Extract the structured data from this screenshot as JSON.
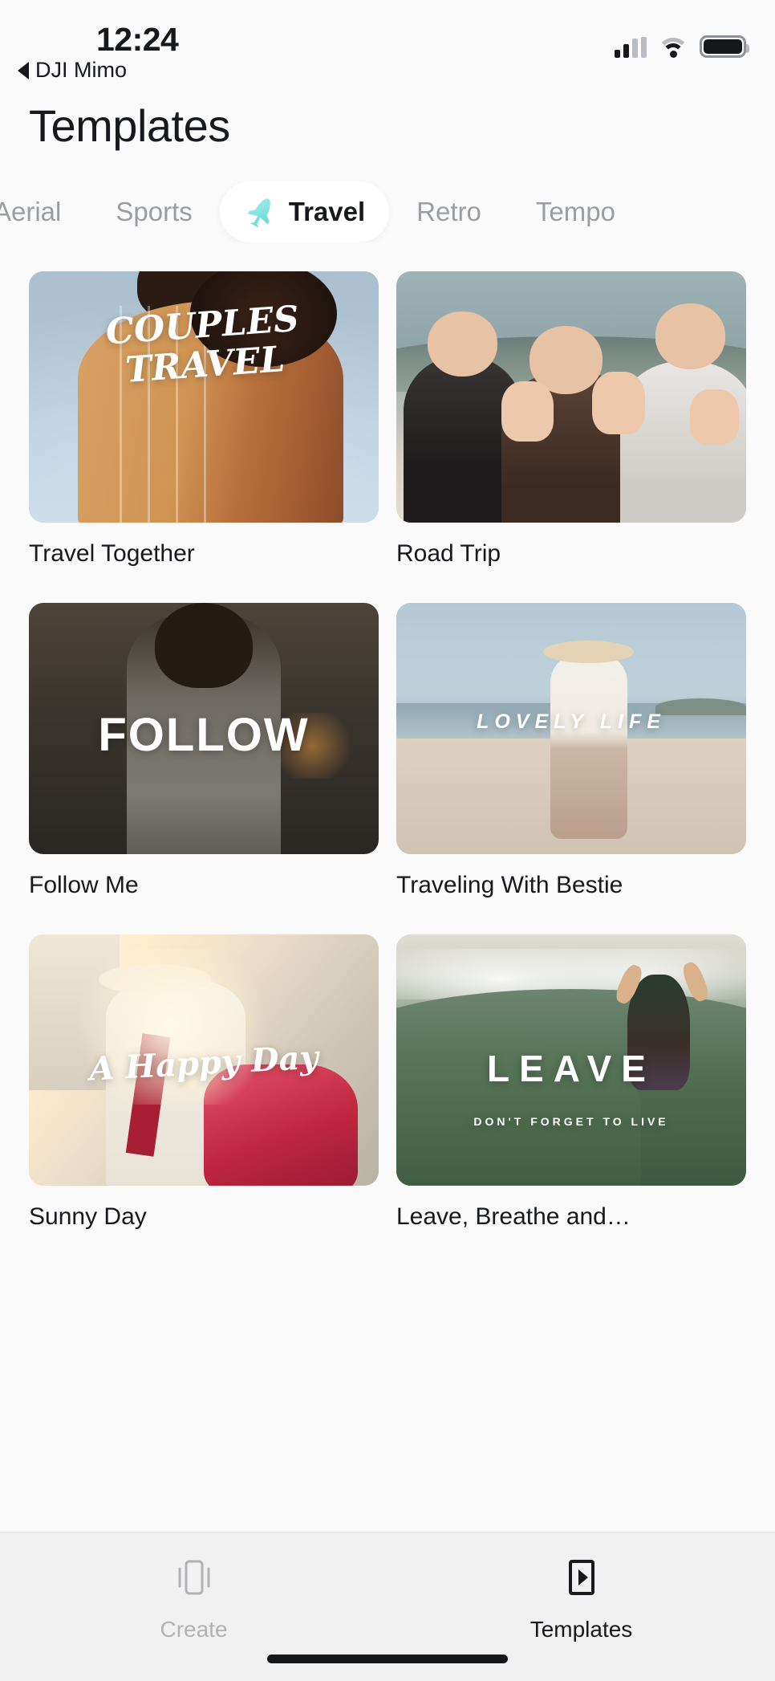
{
  "status_bar": {
    "time": "12:24",
    "back_label": "DJI Mimo",
    "back_icon": "triangle-left-icon",
    "signal_icon": "cellular-signal-icon",
    "wifi_icon": "wifi-icon",
    "battery_icon": "battery-full-icon"
  },
  "header": {
    "title": "Templates"
  },
  "tabs": {
    "items": [
      {
        "label": "Aerial",
        "active": false
      },
      {
        "label": "Sports",
        "active": false
      },
      {
        "label": "Travel",
        "active": true,
        "icon": "airplane-icon",
        "icon_color": "#7fe3df"
      },
      {
        "label": "Retro",
        "active": false
      },
      {
        "label": "Tempo",
        "active": false
      }
    ]
  },
  "templates": [
    {
      "label": "Travel Together",
      "overlay": "COUPLES TRAVEL",
      "thumb": "couple-hugging-photo"
    },
    {
      "label": "Road Trip",
      "overlay": "",
      "thumb": "three-friends-waving-photo"
    },
    {
      "label": "Follow Me",
      "overlay": "FOLLOW",
      "thumb": "woman-walking-away-photo"
    },
    {
      "label": "Traveling With Bestie",
      "overlay": "LOVELY LIFE",
      "thumb": "woman-on-beach-photo"
    },
    {
      "label": "Sunny Day",
      "overlay": "A Happy Day",
      "thumb": "woman-with-backpack-photo"
    },
    {
      "label": "Leave, Breathe and…",
      "overlay": "LEAVE",
      "overlay_sub": "DON'T FORGET TO LIVE",
      "thumb": "person-jumping-mountain-photo"
    }
  ],
  "bottom_nav": {
    "items": [
      {
        "label": "Create",
        "icon": "card-swipe-icon",
        "active": false
      },
      {
        "label": "Templates",
        "icon": "play-rectangle-icon",
        "active": true
      }
    ]
  },
  "colors": {
    "background": "#fafafa",
    "tabbar_background": "#f1f1f1",
    "active_text": "#17191d",
    "inactive_text": "#9a9da2",
    "accent_teal": "#7fe3df"
  }
}
